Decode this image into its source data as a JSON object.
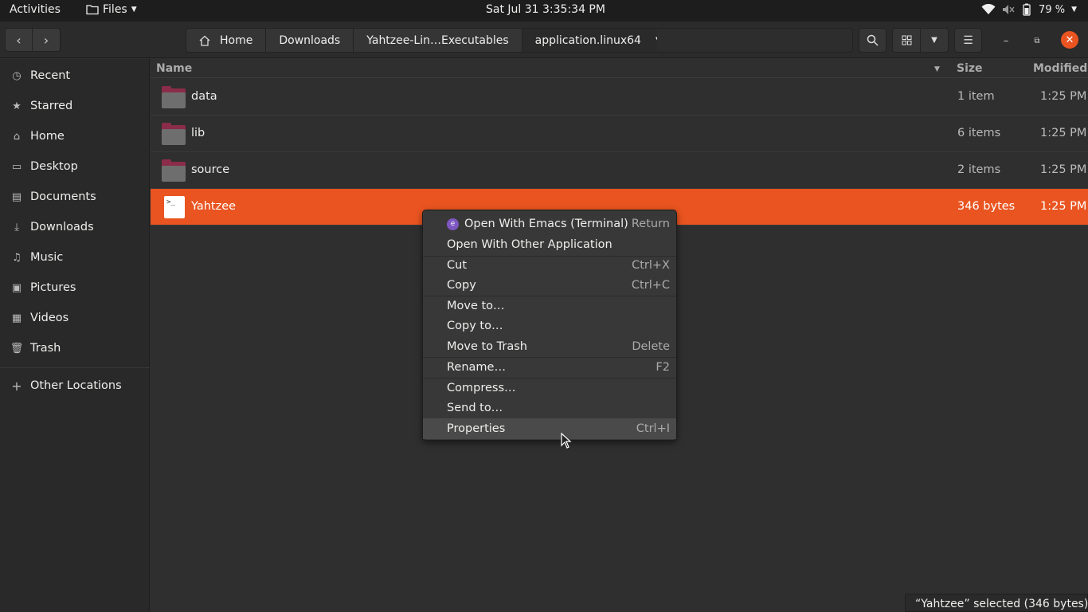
{
  "topbar": {
    "activities": "Activities",
    "app_menu": "Files",
    "clock": "Sat Jul 31   3:35:34 PM",
    "battery": "79 %"
  },
  "header": {
    "breadcrumbs": [
      "Home",
      "Downloads",
      "Yahtzee-Lin…Executables",
      "application.linux64"
    ]
  },
  "sidebar": {
    "items": [
      {
        "label": "Recent",
        "icon": "clock-icon"
      },
      {
        "label": "Starred",
        "icon": "star-icon"
      },
      {
        "label": "Home",
        "icon": "home-icon"
      },
      {
        "label": "Desktop",
        "icon": "desktop-icon"
      },
      {
        "label": "Documents",
        "icon": "document-icon"
      },
      {
        "label": "Downloads",
        "icon": "download-icon"
      },
      {
        "label": "Music",
        "icon": "music-icon"
      },
      {
        "label": "Pictures",
        "icon": "picture-icon"
      },
      {
        "label": "Videos",
        "icon": "video-icon"
      },
      {
        "label": "Trash",
        "icon": "trash-icon"
      }
    ],
    "other_locations": "Other Locations"
  },
  "columns": {
    "name": "Name",
    "size": "Size",
    "modified": "Modified"
  },
  "files": [
    {
      "name": "data",
      "size": "1 item",
      "modified": "1:25 PM",
      "type": "folder"
    },
    {
      "name": "lib",
      "size": "6 items",
      "modified": "1:25 PM",
      "type": "folder"
    },
    {
      "name": "source",
      "size": "2 items",
      "modified": "1:25 PM",
      "type": "folder"
    },
    {
      "name": "Yahtzee",
      "size": "346 bytes",
      "modified": "1:25 PM",
      "type": "executable",
      "selected": true
    }
  ],
  "context_menu": {
    "items": [
      {
        "label": "Open With Emacs (Terminal)",
        "accel": "Return"
      },
      {
        "label": "Open With Other Application",
        "accel": ""
      },
      {
        "label": "Cut",
        "accel": "Ctrl+X"
      },
      {
        "label": "Copy",
        "accel": "Ctrl+C"
      },
      {
        "label": "Move to…",
        "accel": ""
      },
      {
        "label": "Copy to…",
        "accel": ""
      },
      {
        "label": "Move to Trash",
        "accel": "Delete"
      },
      {
        "label": "Rename…",
        "accel": "F2"
      },
      {
        "label": "Compress…",
        "accel": ""
      },
      {
        "label": "Send to…",
        "accel": ""
      },
      {
        "label": "Properties",
        "accel": "Ctrl+I"
      }
    ]
  },
  "status": "“Yahtzee” selected  (346 bytes)",
  "colors": {
    "accent": "#e95420",
    "background": "#2f2f2f",
    "sidebar": "#292929"
  }
}
